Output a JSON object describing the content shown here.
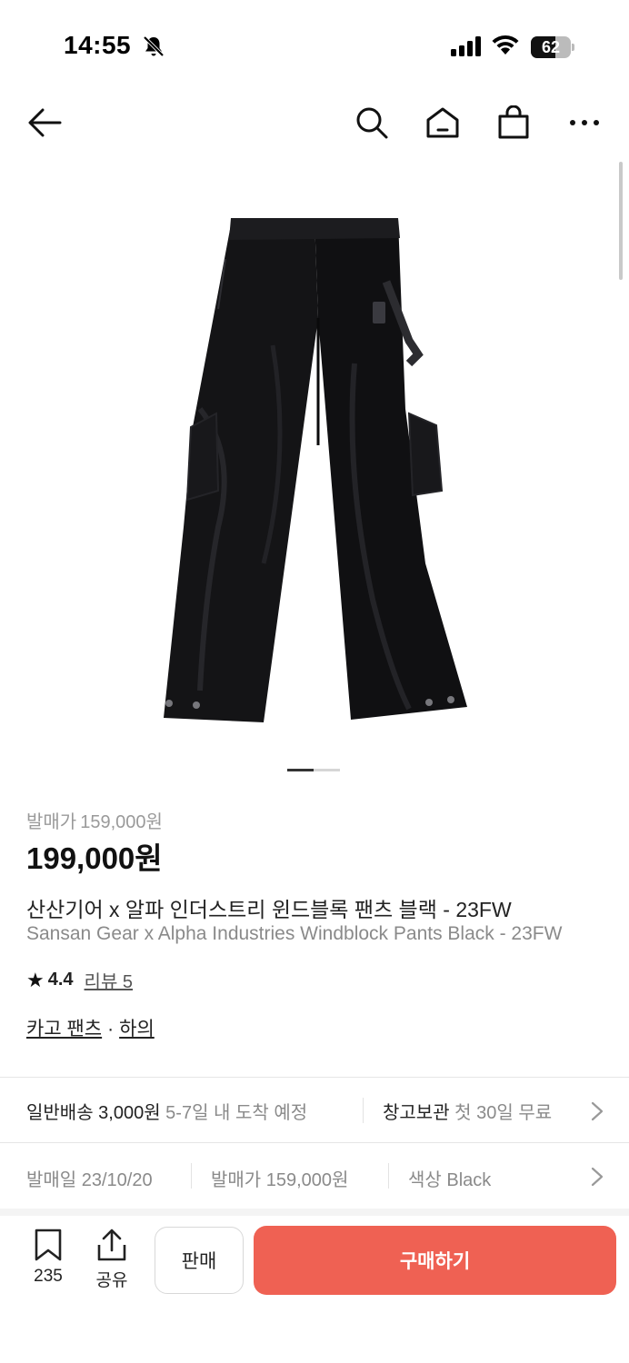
{
  "status_bar": {
    "time": "14:55",
    "battery": "62",
    "battery_level": 0.62
  },
  "nav": {
    "back_icon": "arrow-left-icon",
    "search_icon": "search-icon",
    "home_icon": "home-icon",
    "cart_icon": "shopping-bag-icon",
    "more_icon": "more-horizontal-icon"
  },
  "carousel": {
    "total": 2,
    "active_index": 0
  },
  "product": {
    "release_price_label": "발매가",
    "release_price": "159,000원",
    "price": "199,000원",
    "title_ko": "산산기어 x 알파 인더스트리 윈드블록 팬츠 블랙 - 23FW",
    "title_en": "Sansan Gear x Alpha Industries Windblock Pants Black - 23FW",
    "rating": "4.4",
    "review_label": "리뷰 5",
    "category": "카고 팬츠",
    "category_sep": "·",
    "subcategory": "하의"
  },
  "shipping": {
    "normal_label": "일반배송 3,000원",
    "normal_eta": "5-7일 내 도착 예정",
    "storage_label": "창고보관",
    "storage_desc": "첫 30일 무료"
  },
  "info": {
    "release_date": "발매일 23/10/20",
    "release_price": "발매가 159,000원",
    "color": "색상 Black"
  },
  "bottom": {
    "wish_count": "235",
    "share_label": "공유",
    "sell_label": "판매",
    "buy_label": "구매하기"
  },
  "colors": {
    "accent": "#ef6153"
  }
}
